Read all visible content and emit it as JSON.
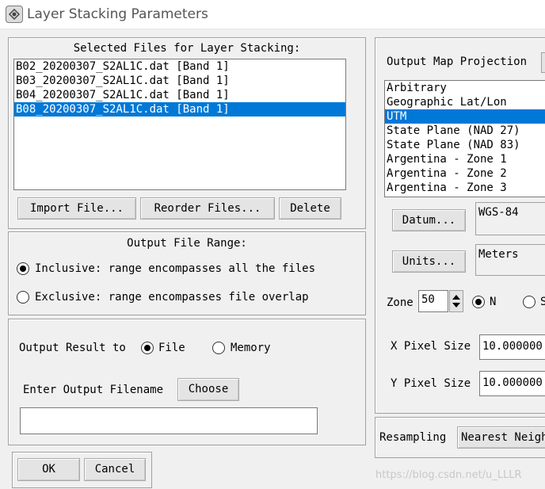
{
  "window": {
    "title": "Layer Stacking Parameters"
  },
  "selected_files": {
    "title": "Selected Files for Layer Stacking:",
    "items": [
      "B02_20200307_S2AL1C.dat [Band 1]",
      "B03_20200307_S2AL1C.dat [Band 1]",
      "B04_20200307_S2AL1C.dat [Band 1]",
      "B08_20200307_S2AL1C.dat [Band 1]"
    ],
    "selected_index": 3,
    "import_label": "Import File...",
    "reorder_label": "Reorder Files...",
    "delete_label": "Delete"
  },
  "output_range": {
    "title": "Output File Range:",
    "inclusive_label": "Inclusive: range encompasses all the files",
    "exclusive_label": "Exclusive: range encompasses file overlap",
    "selected": "inclusive"
  },
  "output": {
    "result_label": "Output Result to",
    "file_label": "File",
    "memory_label": "Memory",
    "selected": "file",
    "filename_label": "Enter Output Filename",
    "choose_label": "Choose",
    "filename_value": ""
  },
  "buttons": {
    "ok": "OK",
    "cancel": "Cancel"
  },
  "projection": {
    "title": "Output Map Projection",
    "items": [
      "Arbitrary",
      "Geographic Lat/Lon",
      "UTM",
      "State Plane (NAD 27)",
      "State Plane (NAD 83)",
      "Argentina - Zone 1",
      "Argentina - Zone 2",
      "Argentina - Zone 3"
    ],
    "selected_index": 2,
    "datum_label": "Datum...",
    "datum_value": "WGS-84",
    "units_label": "Units...",
    "units_value": "Meters",
    "zone_label": "Zone",
    "zone_value": "50",
    "north_label": "N",
    "south_label": "S",
    "hemisphere": "N",
    "x_pixel_label": "X Pixel Size",
    "x_pixel_value": "10.000000",
    "y_pixel_label": "Y Pixel Size",
    "y_pixel_value": "10.000000"
  },
  "resampling": {
    "label": "Resampling",
    "value": "Nearest Neighbor"
  },
  "watermark": "https://blog.csdn.net/u_LLLR"
}
